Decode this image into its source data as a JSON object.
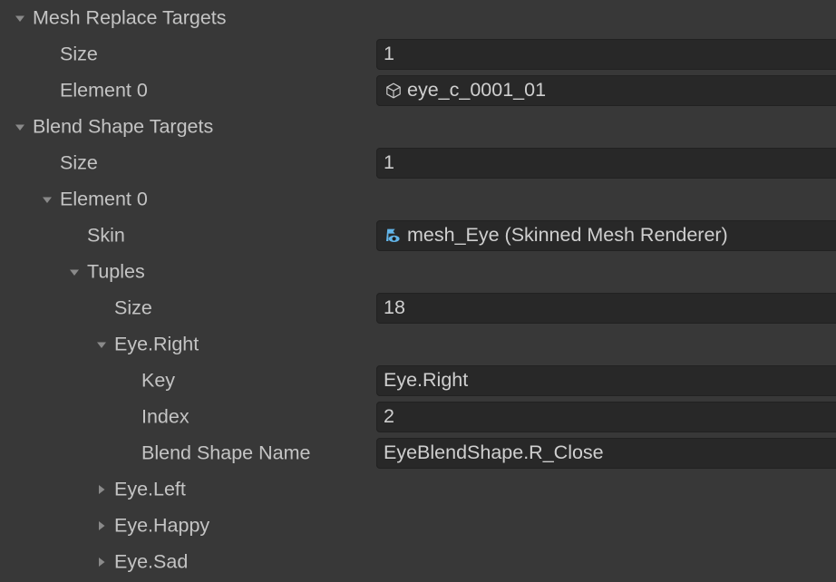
{
  "inspector": {
    "background_color": "#383838",
    "field_color": "#282828",
    "text_color": "#c4c4c4",
    "skin_icon_color": "#62b4e8",
    "rows": [
      {
        "label": "Mesh Replace Targets",
        "indent": 0,
        "foldout": "expanded",
        "field": null
      },
      {
        "label": "Size",
        "indent": 1,
        "foldout": "none",
        "field": {
          "value": "1",
          "icon": "none"
        }
      },
      {
        "label": "Element 0",
        "indent": 1,
        "foldout": "none",
        "field": {
          "value": "eye_c_0001_01",
          "icon": "mesh-icon"
        }
      },
      {
        "label": "Blend Shape Targets",
        "indent": 0,
        "foldout": "expanded",
        "field": null
      },
      {
        "label": "Size",
        "indent": 1,
        "foldout": "none",
        "field": {
          "value": "1",
          "icon": "none"
        }
      },
      {
        "label": "Element 0",
        "indent": 1,
        "foldout": "expanded",
        "field": null
      },
      {
        "label": "Skin",
        "indent": 2,
        "foldout": "none",
        "field": {
          "value": "mesh_Eye (Skinned Mesh Renderer)",
          "icon": "skinned-mesh-renderer-icon"
        }
      },
      {
        "label": "Tuples",
        "indent": 2,
        "foldout": "expanded",
        "field": null
      },
      {
        "label": "Size",
        "indent": 3,
        "foldout": "none",
        "field": {
          "value": "18",
          "icon": "none"
        }
      },
      {
        "label": "Eye.Right",
        "indent": 3,
        "foldout": "expanded",
        "field": null
      },
      {
        "label": "Key",
        "indent": 4,
        "foldout": "none",
        "field": {
          "value": "Eye.Right",
          "icon": "none"
        }
      },
      {
        "label": "Index",
        "indent": 4,
        "foldout": "none",
        "field": {
          "value": "2",
          "icon": "none"
        }
      },
      {
        "label": "Blend Shape Name",
        "indent": 4,
        "foldout": "none",
        "field": {
          "value": "EyeBlendShape.R_Close",
          "icon": "none"
        }
      },
      {
        "label": "Eye.Left",
        "indent": 3,
        "foldout": "collapsed",
        "field": null
      },
      {
        "label": "Eye.Happy",
        "indent": 3,
        "foldout": "collapsed",
        "field": null
      },
      {
        "label": "Eye.Sad",
        "indent": 3,
        "foldout": "collapsed",
        "field": null
      }
    ]
  }
}
